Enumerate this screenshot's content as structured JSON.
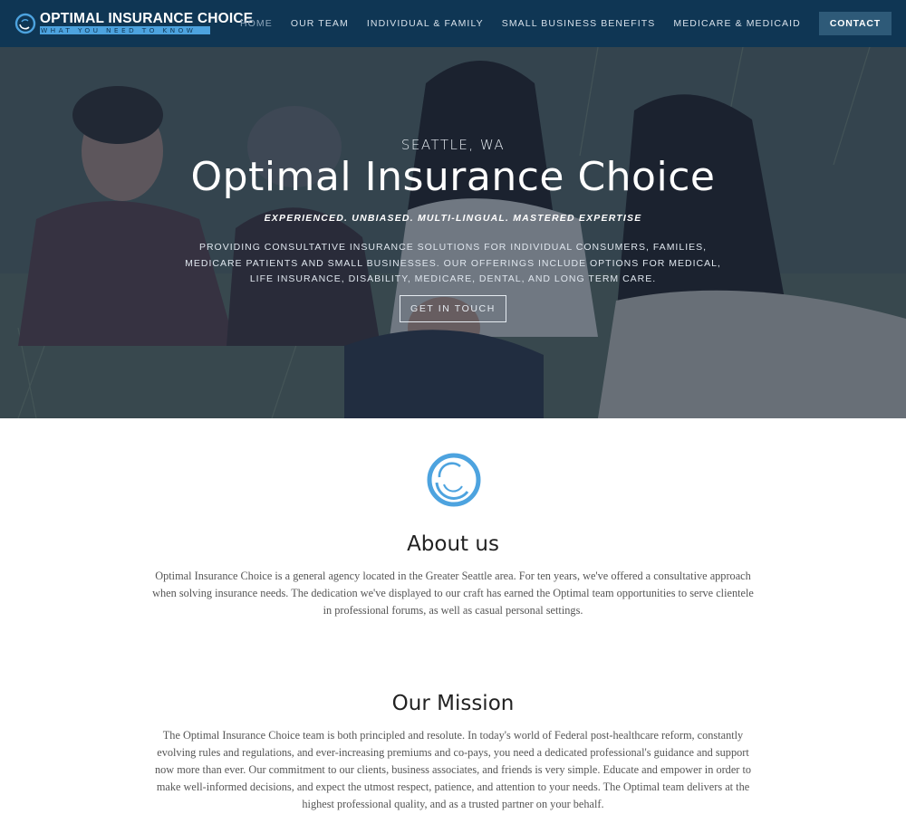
{
  "brand": {
    "title": "OPTIMAL INSURANCE CHOICE",
    "tagline": "WHAT YOU NEED TO KNOW"
  },
  "nav": {
    "items": [
      {
        "label": "HOME"
      },
      {
        "label": "OUR TEAM"
      },
      {
        "label": "INDIVIDUAL & FAMILY"
      },
      {
        "label": "SMALL BUSINESS BENEFITS"
      },
      {
        "label": "MEDICARE & MEDICAID"
      }
    ],
    "active": "HOME",
    "contact": "CONTACT"
  },
  "hero": {
    "kicker": "SEATTLE, WA",
    "title": "Optimal Insurance Choice",
    "subtitle": "EXPERIENCED. UNBIASED. MULTI-LINGUAL. MASTERED EXPERTISE",
    "description": "PROVIDING CONSULTATIVE INSURANCE SOLUTIONS FOR INDIVIDUAL CONSUMERS, FAMILIES, MEDICARE PATIENTS AND SMALL BUSINESSES. OUR OFFERINGS INCLUDE OPTIONS FOR MEDICAL, LIFE INSURANCE, DISABILITY,  MEDICARE, DENTAL, AND LONG TERM CARE.",
    "button": "GET IN TOUCH"
  },
  "about": {
    "title": "About us",
    "text": "Optimal Insurance Choice is a general agency located in the Greater Seattle area.  For ten years, we've offered a consultative approach when solving insurance needs.  The dedication we've displayed to our craft has earned the Optimal team opportunities to serve clientele in professional forums, as well as casual personal settings."
  },
  "mission": {
    "title": "Our Mission",
    "text": "The Optimal Insurance Choice team is both principled and resolute.  In today's world of Federal post-healthcare reform, constantly evolving rules and regulations, and ever-increasing premiums and co-pays, you need a dedicated professional's guidance and support now more than ever.  Our commitment to our clients, business associates, and friends is very simple.  Educate and empower in order to make well-informed decisions, and expect the utmost respect, patience, and attention to your needs.  The Optimal team delivers at the highest professional quality, and as a trusted partner on your behalf."
  },
  "colors": {
    "header_bg": "#0f3654",
    "accent_blue": "#4da3df",
    "contact_bg": "#2e5a78"
  },
  "icons": {
    "logo": "swirl-circle-icon",
    "emblem": "swirl-circle-icon"
  }
}
